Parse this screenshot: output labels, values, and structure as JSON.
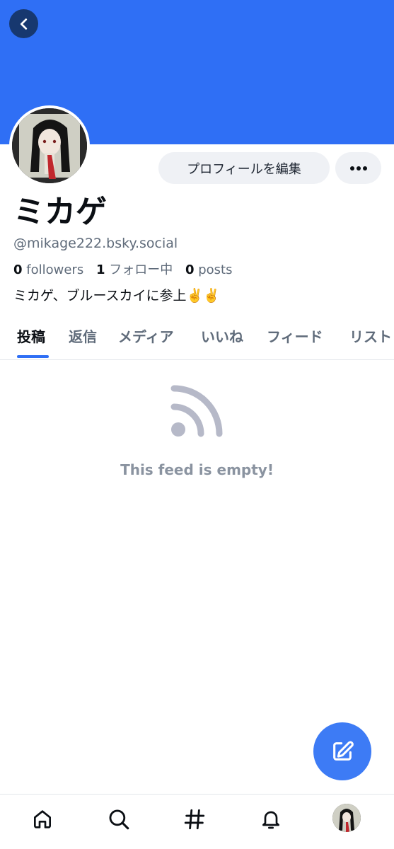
{
  "header": {
    "banner_color": "#2f6ff5",
    "back_icon": "chevron-left-icon"
  },
  "profile": {
    "edit_button_label": "プロフィールを編集",
    "more_icon": "ellipsis-icon",
    "display_name": "ミカゲ",
    "handle": "@mikage222.bsky.social",
    "stats": {
      "followers_count": "0",
      "followers_label": "followers",
      "following_count": "1",
      "following_label": "フォロー中",
      "posts_count": "0",
      "posts_label": "posts"
    },
    "bio": "ミカゲ、ブルースカイに参上✌️✌️"
  },
  "tabs": [
    {
      "label": "投稿"
    },
    {
      "label": "返信"
    },
    {
      "label": "メディア"
    },
    {
      "label": "いいね"
    },
    {
      "label": "フィード"
    },
    {
      "label": "リスト"
    }
  ],
  "active_tab_index": 0,
  "feed": {
    "empty_icon": "rss-icon",
    "empty_message": "This feed is empty!"
  },
  "fab": {
    "icon": "compose-icon",
    "color": "#3d7bf5"
  },
  "bottom_nav": {
    "items": [
      "home-icon",
      "search-icon",
      "hashtag-icon",
      "bell-icon",
      "avatar"
    ]
  }
}
